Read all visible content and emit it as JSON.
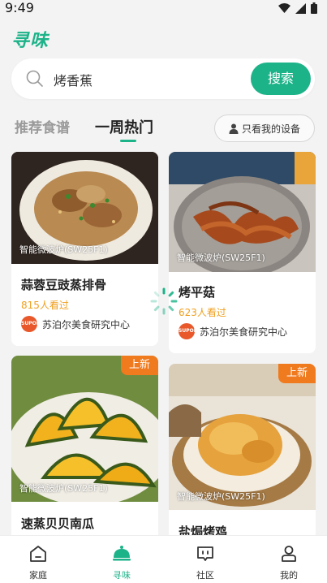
{
  "status_bar": {
    "time": "9:49"
  },
  "app": {
    "logo_text": "寻味"
  },
  "search": {
    "value": "烤香蕉",
    "button_label": "搜索"
  },
  "tabs": [
    {
      "label": "推荐食谱",
      "active": false
    },
    {
      "label": "一周热门",
      "active": true
    }
  ],
  "device_filter": {
    "label": "只看我的设备"
  },
  "recipes": [
    {
      "device": "智能微波炉(SW25F1)",
      "title": "蒜蓉豆豉蒸排骨",
      "views": "815人看过",
      "author": "苏泊尔美食研究中心",
      "avatar_text": "SUPOR",
      "is_new": false
    },
    {
      "device": "智能微波炉(SW25F1)",
      "title": "烤平菇",
      "views": "623人看过",
      "author": "苏泊尔美食研究中心",
      "avatar_text": "SUPOR",
      "is_new": false
    },
    {
      "device": "智能微波炉(SW25F1)",
      "title": "速蒸贝贝南瓜",
      "badge": "上新",
      "is_new": true
    },
    {
      "device": "智能微波炉(SW25F1)",
      "title": "盐焗烤鸡",
      "badge": "上新",
      "is_new": true
    }
  ],
  "bottom_nav": [
    {
      "label": "家庭",
      "icon": "home-icon",
      "active": false
    },
    {
      "label": "寻味",
      "icon": "cloche-icon",
      "active": true
    },
    {
      "label": "社区",
      "icon": "chat-icon",
      "active": false
    },
    {
      "label": "我的",
      "icon": "user-icon",
      "active": false
    }
  ],
  "colors": {
    "accent": "#1db389",
    "badge": "#f07a1e",
    "views": "#f0a020"
  }
}
